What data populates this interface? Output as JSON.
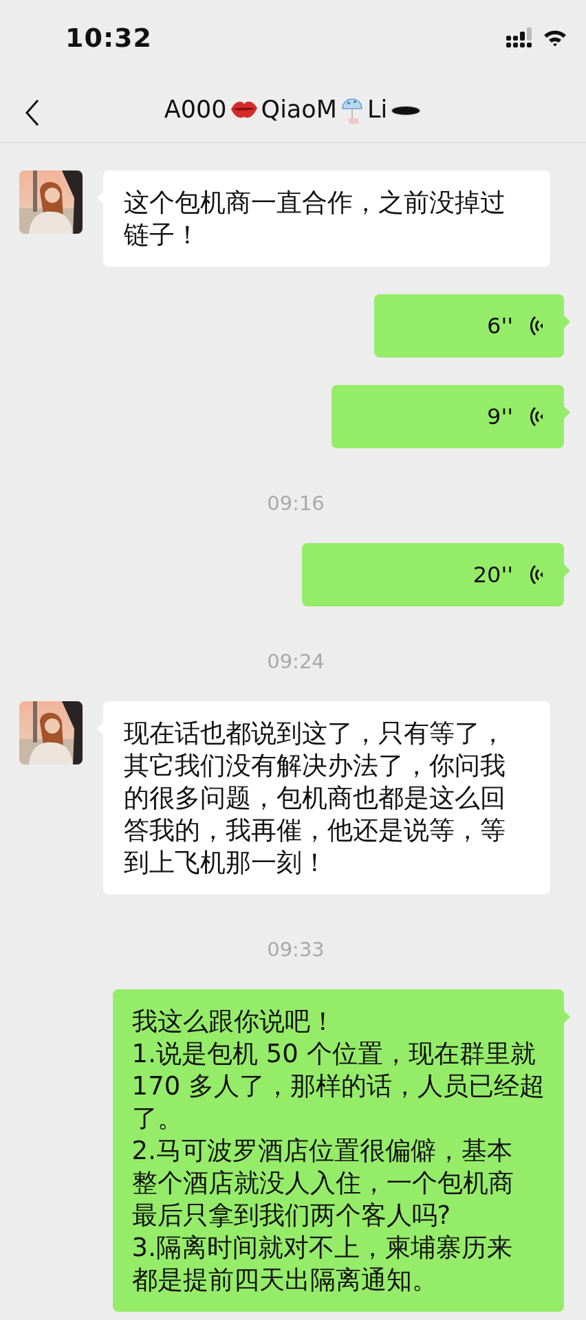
{
  "status_bar": {
    "time": "10:32"
  },
  "nav": {
    "title_segments": [
      "A000",
      "QiaoM",
      "Li"
    ]
  },
  "messages": [
    {
      "kind": "text",
      "outgoing": false,
      "lines": [
        "这个包机商一直合作，之前没掉过",
        "链子！"
      ]
    },
    {
      "kind": "voice",
      "outgoing": true,
      "duration": "6''"
    },
    {
      "kind": "voice",
      "outgoing": true,
      "duration": "9''"
    },
    {
      "kind": "time",
      "text": "09:16"
    },
    {
      "kind": "voice",
      "outgoing": true,
      "duration": "20''"
    },
    {
      "kind": "time",
      "text": "09:24"
    },
    {
      "kind": "text",
      "outgoing": false,
      "lines": [
        "现在话也都说到这了，只有等了，",
        "其它我们没有解决办法了，你问我",
        "的很多问题，包机商也都是这么回",
        "答我的，我再催，他还是说等，等",
        "到上飞机那一刻！"
      ]
    },
    {
      "kind": "time",
      "text": "09:33"
    },
    {
      "kind": "text",
      "outgoing": true,
      "lines": [
        "我这么跟你说吧！",
        "1.说是包机 50 个位置，现在群里就",
        "170 多人了，那样的话，人员已经超",
        "了。",
        "2.马可波罗酒店位置很偏僻，基本",
        "整个酒店就没人入住，一个包机商",
        "最后只拿到我们两个客人吗?",
        "3.隔离时间就对不上，柬埔寨历来",
        "都是提前四天出隔离通知。"
      ]
    }
  ]
}
